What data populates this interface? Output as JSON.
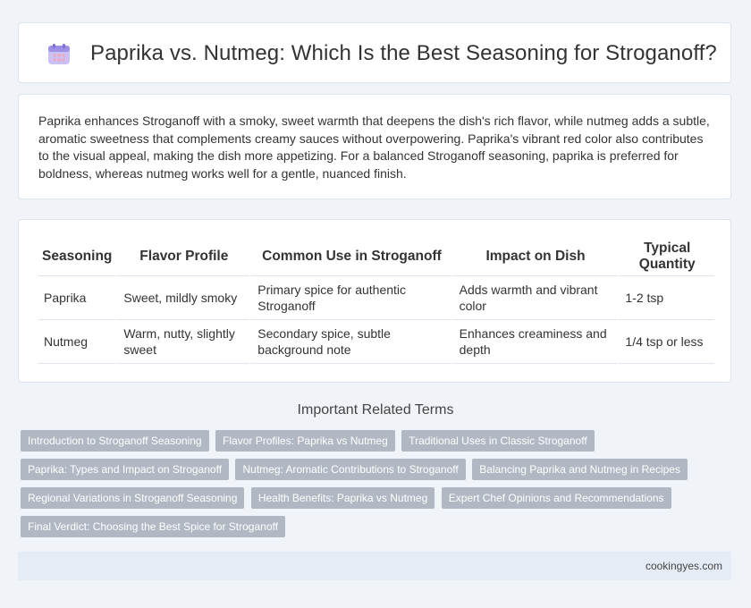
{
  "header": {
    "title": "Paprika vs. Nutmeg: Which Is the Best Seasoning for Stroganoff?",
    "icon": "calendar-icon",
    "icon_colors": [
      "#9c8fe6",
      "#f3a6b5"
    ]
  },
  "intro": {
    "text": "Paprika enhances Stroganoff with a smoky, sweet warmth that deepens the dish's rich flavor, while nutmeg adds a subtle, aromatic sweetness that complements creamy sauces without overpowering. Paprika's vibrant red color also contributes to the visual appeal, making the dish more appetizing. For a balanced Stroganoff seasoning, paprika is preferred for boldness, whereas nutmeg works well for a gentle, nuanced finish."
  },
  "table": {
    "headers": [
      "Seasoning",
      "Flavor Profile",
      "Common Use in Stroganoff",
      "Impact on Dish",
      "Typical Quantity"
    ],
    "rows": [
      [
        "Paprika",
        "Sweet, mildly smoky",
        "Primary spice for authentic Stroganoff",
        "Adds warmth and vibrant color",
        "1-2 tsp"
      ],
      [
        "Nutmeg",
        "Warm, nutty, slightly sweet",
        "Secondary spice, subtle background note",
        "Enhances creaminess and depth",
        "1/4 tsp or less"
      ]
    ]
  },
  "related": {
    "title": "Important Related Terms",
    "tags": [
      "Introduction to Stroganoff Seasoning",
      "Flavor Profiles: Paprika vs Nutmeg",
      "Traditional Uses in Classic Stroganoff",
      "Paprika: Types and Impact on Stroganoff",
      "Nutmeg: Aromatic Contributions to Stroganoff",
      "Balancing Paprika and Nutmeg in Recipes",
      "Regional Variations in Stroganoff Seasoning",
      "Health Benefits: Paprika vs Nutmeg",
      "Expert Chef Opinions and Recommendations",
      "Final Verdict: Choosing the Best Spice for Stroganoff"
    ]
  },
  "footer": {
    "site": "cookingyes.com"
  }
}
